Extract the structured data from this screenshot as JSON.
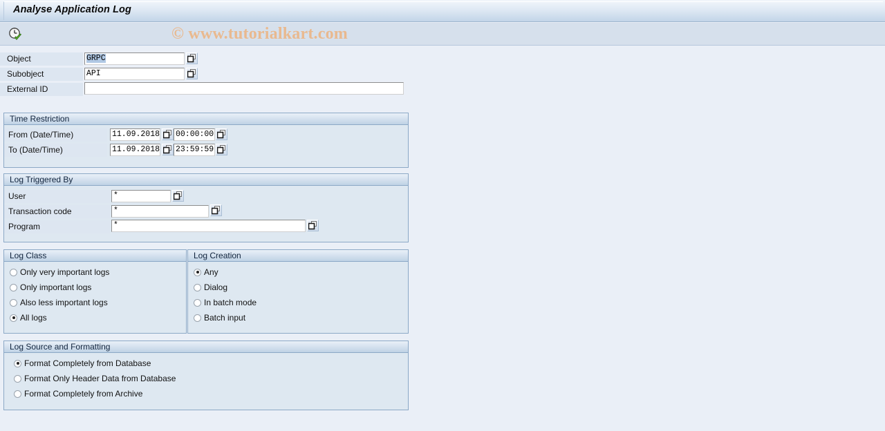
{
  "window": {
    "title": "Analyse Application Log"
  },
  "toolbar": {
    "execute_icon": "clock-check-icon",
    "execute_tooltip": "Execute"
  },
  "watermark": {
    "text": "© www.tutorialkart.com",
    "color": "#e9b98f"
  },
  "selection": {
    "fields": [
      {
        "label": "Object",
        "value": "GRPC",
        "selected_text": true,
        "has_matchcode": true
      },
      {
        "label": "Subobject",
        "value": "API",
        "selected_text": false,
        "has_matchcode": true
      },
      {
        "label": "External ID",
        "value": "",
        "selected_text": false,
        "has_matchcode": false
      }
    ]
  },
  "time_restriction": {
    "title": "Time Restriction",
    "rows": [
      {
        "label": "From (Date/Time)",
        "date": "11.09.2018",
        "time": "00:00:00"
      },
      {
        "label": "To (Date/Time)",
        "date": "11.09.2018",
        "time": "23:59:59"
      }
    ]
  },
  "log_triggered_by": {
    "title": "Log Triggered By",
    "rows": [
      {
        "label": "User",
        "value": "*"
      },
      {
        "label": "Transaction code",
        "value": "*"
      },
      {
        "label": "Program",
        "value": "*"
      }
    ]
  },
  "log_class": {
    "title": "Log Class",
    "options": [
      {
        "label": "Only very important logs",
        "selected": false
      },
      {
        "label": "Only important logs",
        "selected": false
      },
      {
        "label": "Also less important logs",
        "selected": false
      },
      {
        "label": "All logs",
        "selected": true
      }
    ]
  },
  "log_creation": {
    "title": "Log Creation",
    "options": [
      {
        "label": "Any",
        "selected": true
      },
      {
        "label": "Dialog",
        "selected": false
      },
      {
        "label": "In batch mode",
        "selected": false
      },
      {
        "label": "Batch input",
        "selected": false
      }
    ]
  },
  "log_source": {
    "title": "Log Source and Formatting",
    "options": [
      {
        "label": "Format Completely from Database",
        "selected": true
      },
      {
        "label": "Format Only Header Data from Database",
        "selected": false
      },
      {
        "label": "Format Completely from Archive",
        "selected": false
      }
    ]
  },
  "colors": {
    "page_background": "#eaeff7",
    "group_background": "#dee8f1",
    "group_border": "#8ba8c6",
    "titlebar_gradient_top": "#f2f6fb",
    "titlebar_gradient_bottom": "#c3d5e8",
    "toolbar_background": "#d6e0ec",
    "selection_highlight": "#b0c8e4"
  }
}
